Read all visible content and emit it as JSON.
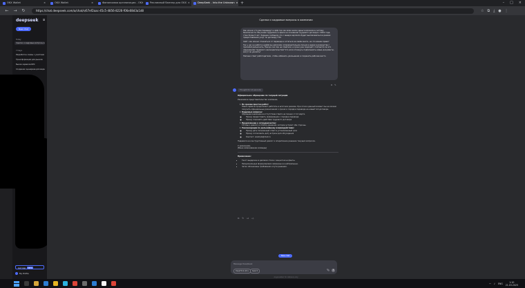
{
  "browser": {
    "tabs": [
      {
        "label": "OKX Wallet"
      },
      {
        "label": "OKX Wallet"
      },
      {
        "label": "Финансовая организация - OKX"
      },
      {
        "label": "Рекламный баннер для OKX"
      },
      {
        "label": "DeepSeek - Into the Unknown",
        "active": true
      }
    ],
    "url": "https://chat.deepseek.com/a/chat/s/67ef2aac-45c5-4856-8226-f06e08d3a1d8"
  },
  "sidebar": {
    "logo": "deepseek",
    "new_chat": "New chat",
    "section_today": "Today",
    "section_7days": "7 Days",
    "items": [
      "Сделка и кадровые вопросы в компании",
      "Разработка схемы с участием",
      "Трансформация для рынков",
      "Вызов сервисов RPC",
      "Создание сценариев для видео"
    ],
    "get_app": "Get App",
    "new_badge": "NEW",
    "profile": "My Profile"
  },
  "chat": {
    "title": "Сделка и кадровые вопросы в компании",
    "user_message": [
      "Как можно что рам переведут в офф.так как всем жалко деньги вложили в систему безопасности. Мы ранее трудились в офисе на основании трудового договора с 2019 года, стаж более 5 лет. Заранее сообщили что с января зарплата будет выплачиваться в рамках предоставления услуг по договору ГПХ.",
      "Сайт: как можно отказаться от перевода и остаться на своём месте, на что имеем право?",
      "Так у нас на работе в дейф мы написали сопроводительное письмо в адрес руководства с просьбой разъяснить. Нам до сих пор не ответили, а сроки уже подходят. Считается ли это нарушением трудового законодательства? Что если откажусь подписывать новые документы, могут ли уволить?",
      "Напиши ответ работодателю, чтобы избежать увольнения и сохранить рабочее место."
    ],
    "think_label": "Thought for 14 seconds",
    "answer": {
      "heading": "Официальное обращение по текущей ситуации",
      "intro": "Уважаемое представительство компании,",
      "items": [
        {
          "title": "По срокам простоя работ:",
          "text": "Наши сервисы продолжают работать в штатном режиме. При этом в данный момент мы не можем получить официальные разъяснения о сроках и порядке перевода на новый тип договора."
        },
        {
          "title": "Кадровые вопросы:",
          "text": "Обращаем внимание на отсутствие ответа на письмо от 12 марта.",
          "bullets": [
            "Прошу предоставить информацию о порядке перевода",
            "Прошу сохранить действие трудового договора"
          ]
        },
        {
          "title": "Предложение о сотрудничестве:",
          "text": "Готовы к диалогу и поиску решения, которое устроит обе стороны."
        },
        {
          "title": "Рекомендации по дальнейшему взаимодействию:",
          "bullets": [
            "Прошу дать письменный ответ в установленный срок",
            "Прошу согласовать дату встречи для обсуждения",
            "Контакт: example@mail.ru"
          ]
        }
      ],
      "closing": "Надеемся на конструктивный диалог и оперативное решение текущих вопросов.",
      "regards": "С уважением,",
      "signature": "[Ваше имя/название команды]",
      "note_heading": "Примечание:",
      "notes": [
        "Текст выдержан в деловом стиле с акцентом на факты.",
        "Эмоциональные формулировки заменены на нейтральные.",
        "Четко обозначены требования и пути решения."
      ]
    },
    "new_chat_pill": "New chat",
    "composer_placeholder": "Message DeepSeek",
    "deepthink_label": "DeepThink (R1)",
    "search_label": "Search",
    "disclaimer": "AI-generated, for reference only"
  },
  "taskbar": {
    "lang": "ENG",
    "time": "1:10",
    "date": "21.03.2025"
  },
  "colors": {
    "accent": "#4d6bfe",
    "page_bg": "#292a2d",
    "sidebar_bg": "#18181b"
  }
}
